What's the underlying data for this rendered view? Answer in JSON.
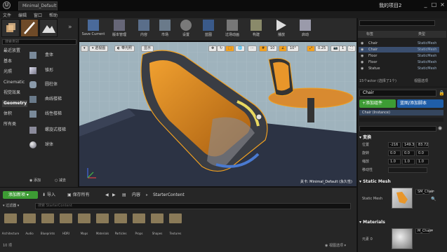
{
  "window": {
    "tab_title": "Minimal_Default",
    "project_name": "我的项目2"
  },
  "menu": [
    "文件",
    "编辑",
    "窗口",
    "帮助"
  ],
  "modes": {
    "search_placeholder": "搜索类别",
    "categories": [
      {
        "label": "最近放置",
        "selected": false
      },
      {
        "label": "基本",
        "selected": false
      },
      {
        "label": "光照",
        "selected": false
      },
      {
        "label": "Cinematic",
        "selected": false
      },
      {
        "label": "视觉效果",
        "selected": false
      },
      {
        "label": "Geometry",
        "selected": true
      },
      {
        "label": "体积",
        "selected": false
      },
      {
        "label": "所有类",
        "selected": false
      }
    ],
    "items": [
      {
        "label": "盒体",
        "icon": "box-brush-icon"
      },
      {
        "label": "锥形",
        "icon": "cone-brush-icon"
      },
      {
        "label": "圆柱体",
        "icon": "cylinder-brush-icon"
      },
      {
        "label": "曲线楼梯",
        "icon": "curved-stairs-icon"
      },
      {
        "label": "线性楼梯",
        "icon": "linear-stairs-icon"
      },
      {
        "label": "螺旋式楼梯",
        "icon": "spiral-stairs-icon"
      },
      {
        "label": "球体",
        "icon": "sphere-brush-icon"
      }
    ],
    "add_label": "添加",
    "sub_label": "减去"
  },
  "toolbar": [
    {
      "label": "Save Current",
      "icon": "save-icon"
    },
    {
      "label": "版本管理",
      "icon": "source-control-icon"
    },
    {
      "label": "内容",
      "icon": "content-icon"
    },
    {
      "label": "市场",
      "icon": "marketplace-icon"
    },
    {
      "label": "设置",
      "icon": "settings-icon"
    },
    {
      "label": "蓝图",
      "icon": "blueprint-icon"
    },
    {
      "label": "过场动画",
      "icon": "cinematics-icon"
    },
    {
      "label": "构建",
      "icon": "build-icon"
    },
    {
      "label": "播放",
      "icon": "play-icon"
    },
    {
      "label": "启动",
      "icon": "launch-icon"
    }
  ],
  "viewport": {
    "perspective_label": "透视图",
    "lit_label": "带光照",
    "show_label": "显示",
    "grid_value": "10",
    "rotate_value": "10°",
    "scale_value": "0.25",
    "camera_speed": "1",
    "level_caption": "关卡: Minimal_Default (永久性)"
  },
  "content_browser": {
    "add_new_label": "添加新项",
    "import_label": "导入",
    "save_all_label": "保存所有",
    "breadcrumb_root": "内容",
    "breadcrumb_folder": "StarterContent",
    "filters_label": "过滤器",
    "search_placeholder": "搜索 StarterContent",
    "folders": [
      "Architecture",
      "Audio",
      "Blueprints",
      "HDRI",
      "Maps",
      "Materials",
      "Particles",
      "Props",
      "Shapes",
      "Textures"
    ],
    "status": "10 项",
    "view_options": "视图选项"
  },
  "outliner": {
    "columns": {
      "label": "标签",
      "type": "类型"
    },
    "rows": [
      {
        "name": "Chair",
        "type": "StaticMesh",
        "selected": false
      },
      {
        "name": "Chair",
        "type": "StaticMesh",
        "selected": true
      },
      {
        "name": "Floor",
        "type": "StaticMesh",
        "selected": false
      },
      {
        "name": "Floor",
        "type": "StaticMesh",
        "selected": false
      },
      {
        "name": "Statue",
        "type": "StaticMesh",
        "selected": false
      }
    ],
    "status": "15个actor (选择了1个)",
    "view_options": "视图选项"
  },
  "details": {
    "actor_name": "Chair",
    "add_component_label": "+添加组件",
    "blueprint_label": "蓝图/添加脚本",
    "instance_label": "Chair (Instance)",
    "transform_section": "变换",
    "location_label": "位置",
    "rotation_label": "旋转",
    "scale_label": "缩放",
    "mobility_label": "移动性",
    "location": [
      "-216",
      "149.3",
      "83.72"
    ],
    "rotation": [
      "0.0",
      "0.0",
      "0.0"
    ],
    "scale": [
      "1.0",
      "1.0",
      "1.0"
    ],
    "static_mesh_section": "Static Mesh",
    "static_mesh_label": "Static Mesh",
    "static_mesh_value": "SM_Chair",
    "materials_section": "Materials",
    "element_label": "元素 0",
    "material_value": "M_Chair"
  }
}
